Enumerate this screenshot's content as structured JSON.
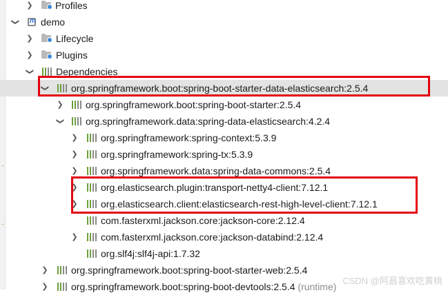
{
  "tree": {
    "profiles": "Profiles",
    "demo": "demo",
    "lifecycle": "Lifecycle",
    "plugins": "Plugins",
    "dependencies": "Dependencies",
    "deps": [
      "org.springframework.boot:spring-boot-starter-data-elasticsearch:2.5.4",
      "org.springframework.boot:spring-boot-starter:2.5.4",
      "org.springframework.data:spring-data-elasticsearch:4.2.4",
      "org.springframework:spring-context:5.3.9",
      "org.springframework:spring-tx:5.3.9",
      "org.springframework.data:spring-data-commons:2.5.4",
      "org.elasticsearch.plugin:transport-netty4-client:7.12.1",
      "org.elasticsearch.client:elasticsearch-rest-high-level-client:7.12.1",
      "com.fasterxml.jackson.core:jackson-core:2.12.4",
      "com.fasterxml.jackson.core:jackson-databind:2.12.4",
      "org.slf4j:slf4j-api:1.7.32",
      "org.springframework.boot:spring-boot-starter-web:2.5.4",
      "org.springframework.boot:spring-boot-devtools:2.5.4"
    ],
    "runtime_note": "(runtime)"
  },
  "watermark": "CSDN @阿昌喜欢吃黄桃",
  "highlight_color": "#e3000f"
}
